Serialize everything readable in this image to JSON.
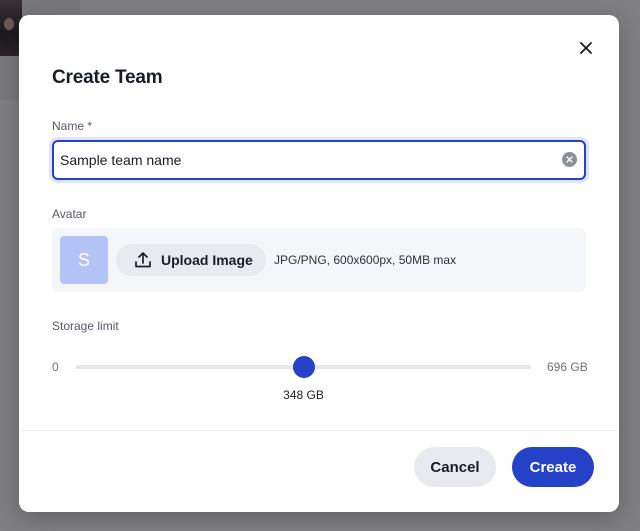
{
  "modal": {
    "title": "Create Team",
    "close_icon": "close-icon"
  },
  "name_field": {
    "label": "Name *",
    "value": "Sample team name",
    "clear_icon": "clear-circle-icon"
  },
  "avatar_field": {
    "label": "Avatar",
    "avatar_initial": "S",
    "upload_label": "Upload Image",
    "upload_icon": "upload-icon",
    "hint": "JPG/PNG, 600x600px, 50MB max"
  },
  "storage_field": {
    "label": "Storage limit",
    "min_label": "0",
    "max_label": "696 GB",
    "min": 0,
    "max": 696,
    "value": 348,
    "value_label": "348 GB"
  },
  "footer": {
    "cancel_label": "Cancel",
    "create_label": "Create"
  },
  "colors": {
    "accent": "#2541c7",
    "avatar_bg": "#b5c4f7",
    "secondary_button": "#e9eaef",
    "overlay": "#777779"
  }
}
